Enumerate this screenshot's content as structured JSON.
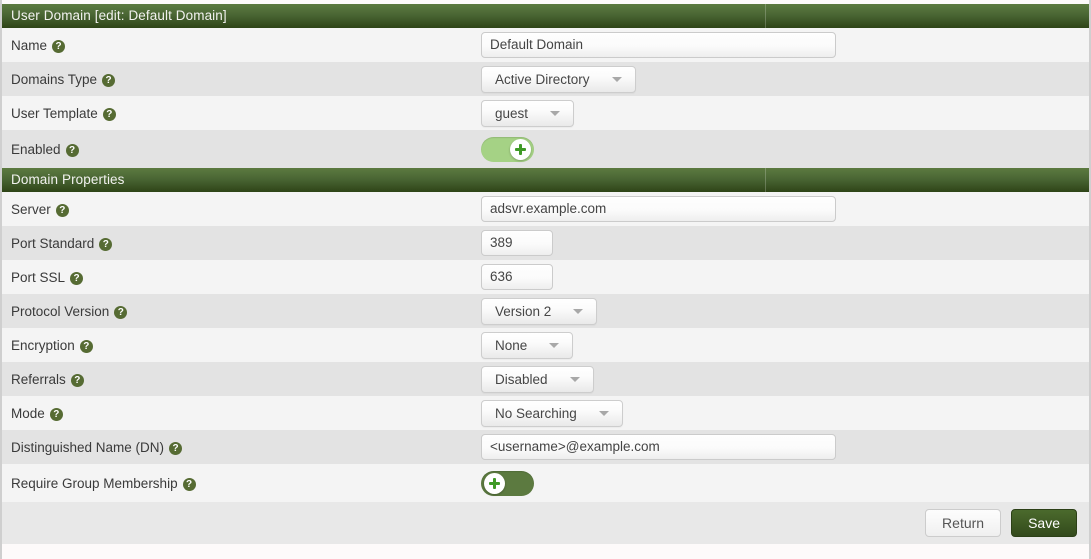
{
  "sections": [
    {
      "title": "User Domain [edit: Default Domain]",
      "rows": [
        {
          "label": "Name",
          "help": "?",
          "type": "text",
          "value": "Default Domain",
          "width": "wide"
        },
        {
          "label": "Domains Type",
          "help": "?",
          "type": "dropdown",
          "value": "Active Directory"
        },
        {
          "label": "User Template",
          "help": "?",
          "type": "dropdown",
          "value": "guest"
        },
        {
          "label": "Enabled",
          "help": "?",
          "type": "toggle",
          "value": "on"
        }
      ]
    },
    {
      "title": "Domain Properties",
      "rows": [
        {
          "label": "Server",
          "help": "?",
          "type": "text",
          "value": "adsvr.example.com",
          "width": "wide"
        },
        {
          "label": "Port Standard",
          "help": "?",
          "type": "text",
          "value": "389",
          "width": "small"
        },
        {
          "label": "Port SSL",
          "help": "?",
          "type": "text",
          "value": "636",
          "width": "small"
        },
        {
          "label": "Protocol Version",
          "help": "?",
          "type": "dropdown",
          "value": "Version 2"
        },
        {
          "label": "Encryption",
          "help": "?",
          "type": "dropdown",
          "value": "None"
        },
        {
          "label": "Referrals",
          "help": "?",
          "type": "dropdown",
          "value": "Disabled"
        },
        {
          "label": "Mode",
          "help": "?",
          "type": "dropdown",
          "value": "No Searching"
        },
        {
          "label": "Distinguished Name (DN)",
          "help": "?",
          "type": "text",
          "value": "<username>@example.com",
          "width": "wide"
        },
        {
          "label": "Require Group Membership",
          "help": "?",
          "type": "toggle",
          "value": "off"
        }
      ]
    }
  ],
  "footer": {
    "return_label": "Return",
    "save_label": "Save"
  },
  "colors": {
    "header_green_top": "#5c7a40",
    "header_green_bottom": "#2e4417",
    "save_button_green": "#3c5722",
    "toggle_on_track": "#a5d285",
    "toggle_off_track": "#5c7a40",
    "help_icon": "#566b33",
    "row_light": "#f4f4f4",
    "row_dark": "#e3e3e3",
    "footer_bg": "#e8e8e8"
  },
  "icons": {
    "help": "help-circle-icon",
    "caret": "chevron-down-icon",
    "toggle_knob": "plus-cross-icon"
  }
}
